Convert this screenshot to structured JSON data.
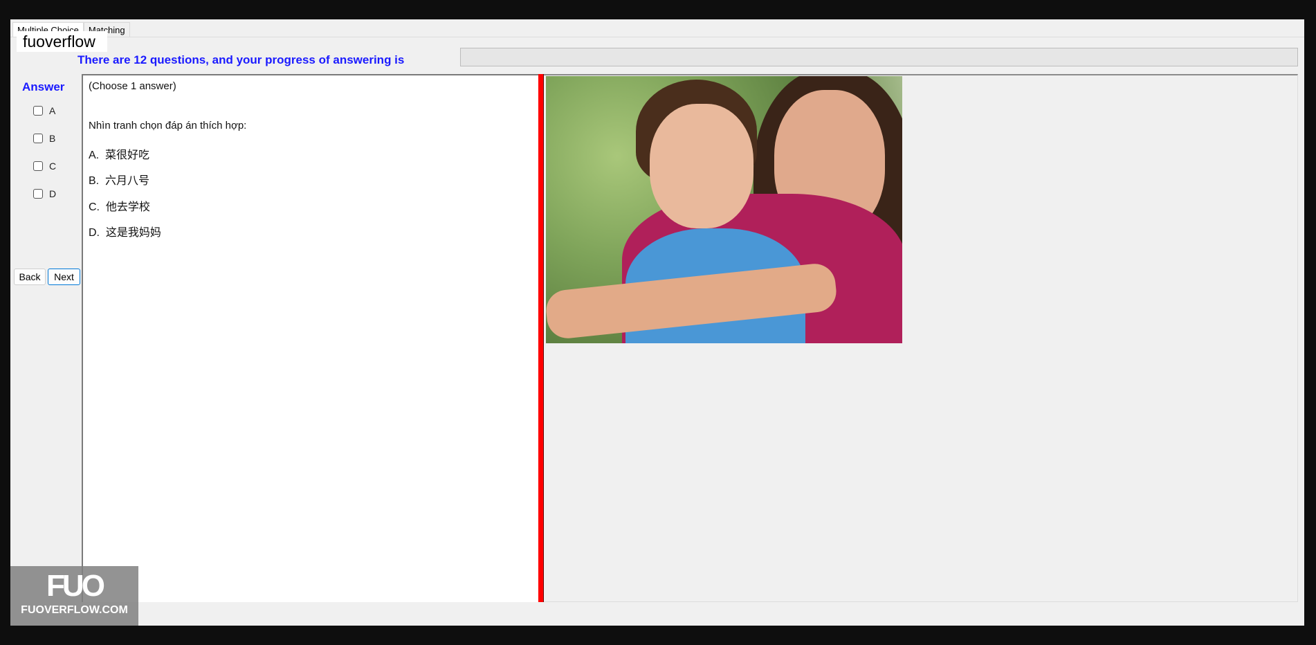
{
  "tabs": [
    {
      "label": "Multiple Choice",
      "active": true
    },
    {
      "label": "Matching",
      "active": false
    }
  ],
  "watermark": "fuoverflow",
  "progress": {
    "text": "There are 12 questions, and your progress of answering is",
    "value_percent": 0
  },
  "answer": {
    "label": "Answer",
    "options": [
      "A",
      "B",
      "C",
      "D"
    ]
  },
  "buttons": {
    "back": "Back",
    "next": "Next"
  },
  "question": {
    "instruction": "(Choose 1 answer)",
    "prompt": "Nhìn tranh chọn đáp án thích hợp:",
    "choices": [
      {
        "letter": "A.",
        "text": "菜很好吃"
      },
      {
        "letter": "B.",
        "text": "六月八号"
      },
      {
        "letter": "C.",
        "text": "他去学校"
      },
      {
        "letter": "D.",
        "text": "这是我妈妈"
      }
    ]
  },
  "image": {
    "description_icon": "photo-mother-and-son"
  },
  "logo": {
    "mark": "FUO",
    "site": "FUOVERFLOW.COM"
  },
  "colors": {
    "accent_text": "#1a1aff",
    "splitter": "#ff0000"
  }
}
